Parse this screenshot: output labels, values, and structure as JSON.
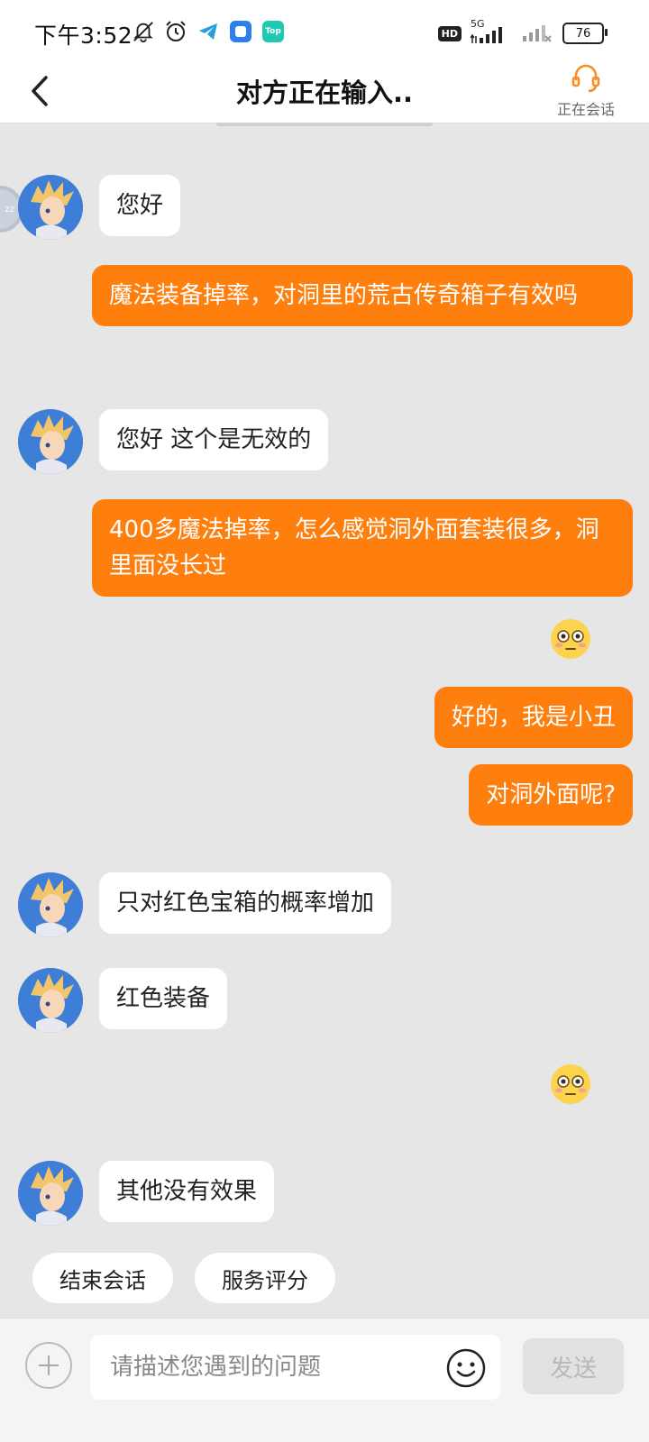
{
  "status_bar": {
    "time": "下午3:52",
    "app_badge_top": "Top",
    "hd": "HD",
    "network": "5G",
    "battery": "76"
  },
  "header": {
    "title": "对方正在输入..",
    "agent_label": "正在会话"
  },
  "floating_ball": {
    "text": "zz"
  },
  "messages": [
    {
      "from": "agent",
      "text": "您好"
    },
    {
      "from": "user",
      "text": "魔法装备掉率，对洞里的荒古传奇箱子有效吗"
    },
    {
      "from": "agent",
      "text": "您好 这个是无效的"
    },
    {
      "from": "user",
      "text": "400多魔法掉率，怎么感觉洞外面套装很多，洞里面没长过"
    },
    {
      "from": "user",
      "emoji": "flushed-face"
    },
    {
      "from": "user",
      "text": "好的，我是小丑"
    },
    {
      "from": "user",
      "text": "对洞外面呢?"
    },
    {
      "from": "agent",
      "text": "只对红色宝箱的概率增加"
    },
    {
      "from": "agent",
      "text": "红色装备"
    },
    {
      "from": "user",
      "emoji": "flushed-face"
    },
    {
      "from": "agent",
      "text": "其他没有效果"
    }
  ],
  "quick_actions": [
    "结束会话",
    "服务评分"
  ],
  "input_bar": {
    "placeholder": "请描述您遇到的问题",
    "send_label": "发送"
  },
  "colors": {
    "user_bubble": "#ff7f0e",
    "agent_bubble": "#ffffff",
    "background": "#e6e6e6",
    "agent_icon": "#ff8a1e"
  }
}
